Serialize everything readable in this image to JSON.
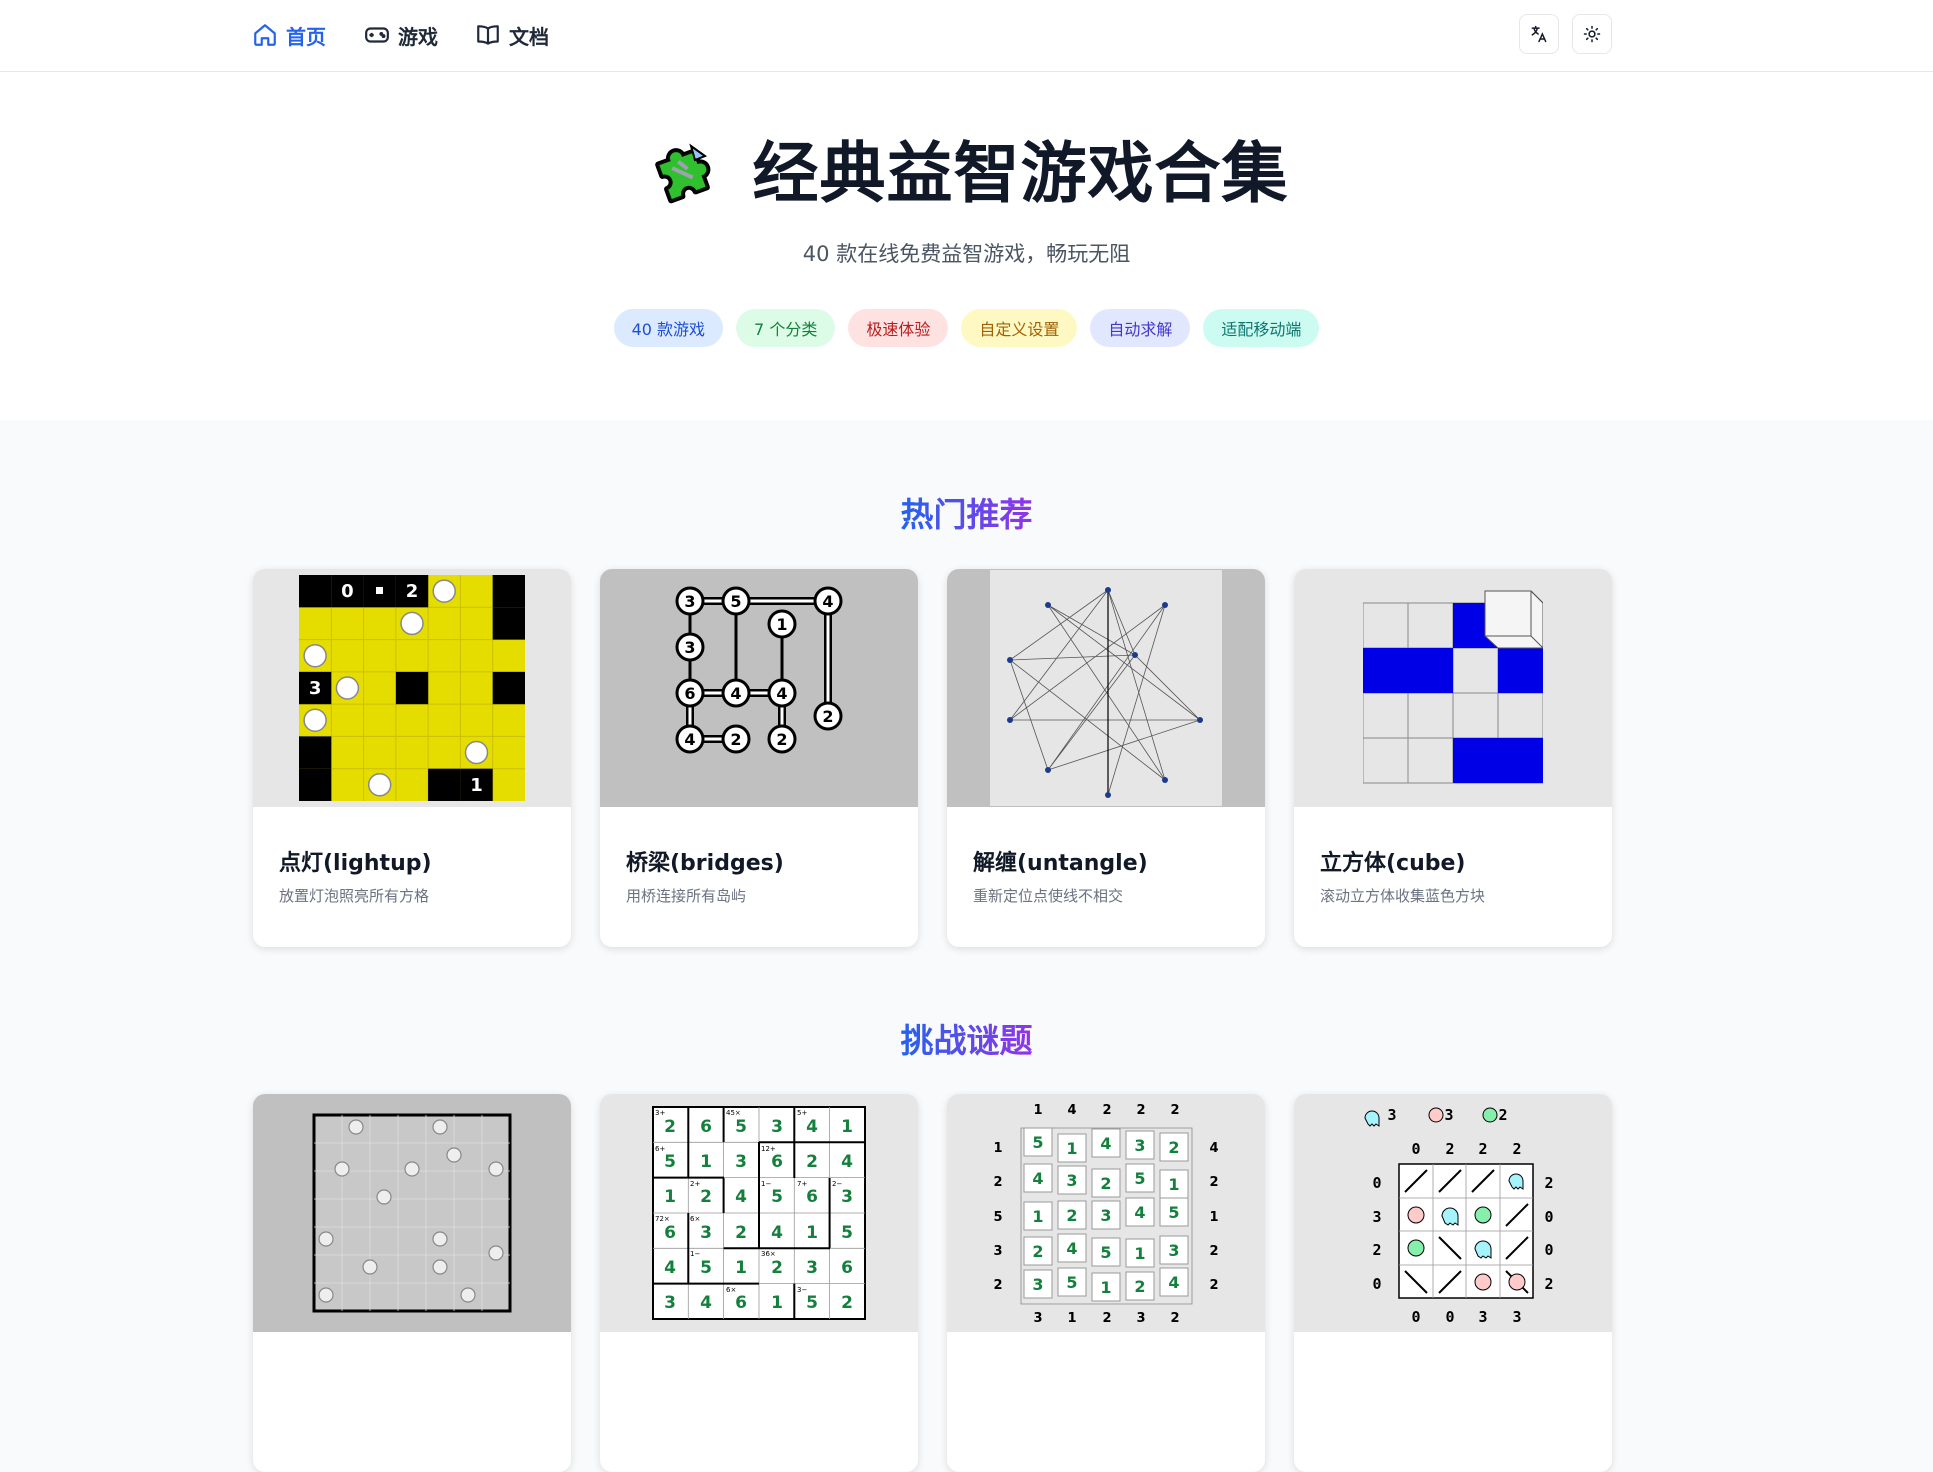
{
  "nav": {
    "items": [
      {
        "label": "首页",
        "icon": "home-icon",
        "active": true
      },
      {
        "label": "游戏",
        "icon": "gamepad-icon"
      },
      {
        "label": "文档",
        "icon": "book-icon"
      }
    ],
    "actions": [
      {
        "icon": "translate-icon"
      },
      {
        "icon": "sun-icon"
      }
    ]
  },
  "hero": {
    "title": "经典益智游戏合集",
    "subtitle": "40 款在线免费益智游戏，畅玩无阻",
    "badges": [
      {
        "label": "40 款游戏",
        "bg": "#dbeafe",
        "fg": "#1d4ed8"
      },
      {
        "label": "7 个分类",
        "bg": "#dcfce7",
        "fg": "#15803d"
      },
      {
        "label": "极速体验",
        "bg": "#fee2e2",
        "fg": "#b91c1c"
      },
      {
        "label": "自定义设置",
        "bg": "#fef9c3",
        "fg": "#a16207"
      },
      {
        "label": "自动求解",
        "bg": "#e0e7ff",
        "fg": "#4338ca"
      },
      {
        "label": "适配移动端",
        "bg": "#ccfbf1",
        "fg": "#0f766e"
      }
    ]
  },
  "sections": [
    {
      "title": "热门推荐",
      "cards": [
        {
          "name": "点灯(lightup)",
          "desc": "放置灯泡照亮所有方格"
        },
        {
          "name": "桥梁(bridges)",
          "desc": "用桥连接所有岛屿"
        },
        {
          "name": "解缠(untangle)",
          "desc": "重新定位点使线不相交"
        },
        {
          "name": "立方体(cube)",
          "desc": "滚动立方体收集蓝色方块"
        }
      ]
    },
    {
      "title": "挑战谜题",
      "cards": [
        {
          "name": "",
          "desc": ""
        },
        {
          "name": "",
          "desc": ""
        },
        {
          "name": "",
          "desc": ""
        },
        {
          "name": "",
          "desc": ""
        }
      ]
    }
  ],
  "colors": {
    "accent": "#2563eb",
    "gradient_end": "#9333ea",
    "lightup_yellow": "#e6dd00",
    "cube_blue": "#0000e6"
  }
}
